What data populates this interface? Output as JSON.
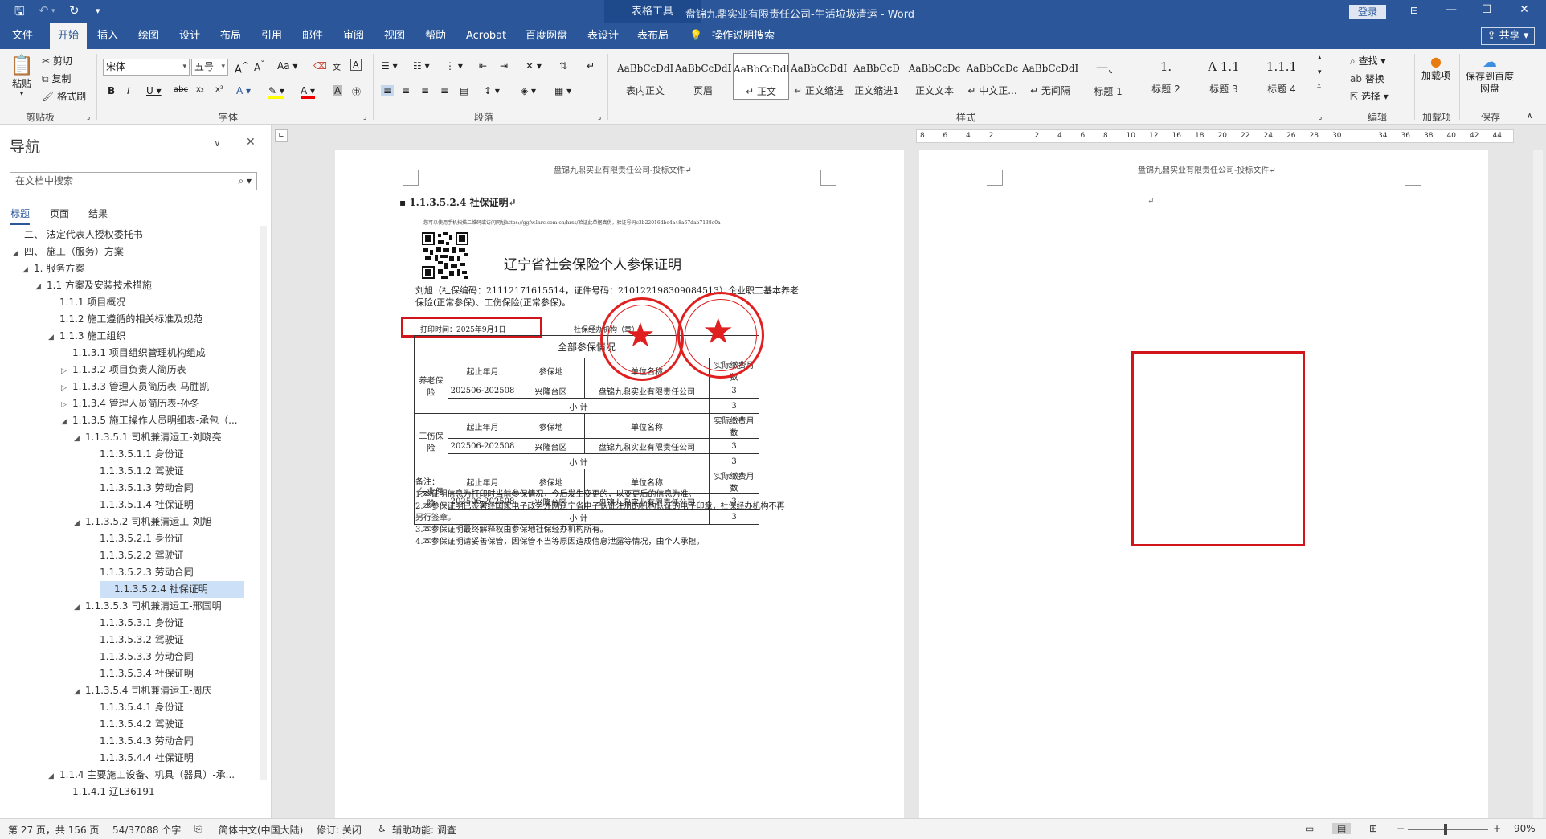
{
  "titlebar": {
    "context_tab": "表格工具",
    "doc_title": "盘锦九鼎实业有限责任公司-生活垃圾清运  -  Word",
    "login": "登录",
    "restore_icon": "ribbon-display-icon",
    "min": "—",
    "max": "☐",
    "close": "✕"
  },
  "tabs": [
    {
      "label": "文件"
    },
    {
      "label": "开始"
    },
    {
      "label": "插入"
    },
    {
      "label": "绘图"
    },
    {
      "label": "设计"
    },
    {
      "label": "布局"
    },
    {
      "label": "引用"
    },
    {
      "label": "邮件"
    },
    {
      "label": "审阅"
    },
    {
      "label": "视图"
    },
    {
      "label": "帮助"
    },
    {
      "label": "Acrobat"
    },
    {
      "label": "百度网盘"
    },
    {
      "label": "表设计"
    },
    {
      "label": "表布局"
    }
  ],
  "tell_me": "操作说明搜索",
  "share": "共享",
  "ribbon": {
    "clipboard": {
      "paste": "粘贴",
      "cut": "剪切",
      "copy": "复制",
      "format_painter": "格式刷",
      "label": "剪贴板"
    },
    "font": {
      "name": "宋体",
      "size": "五号",
      "label": "字体"
    },
    "paragraph": {
      "label": "段落"
    },
    "styles": {
      "label": "样式",
      "items": [
        {
          "preview": "AaBbCcDdI",
          "name": "表内正文"
        },
        {
          "preview": "AaBbCcDdEe",
          "name": "页眉"
        },
        {
          "preview": "AaBbCcDdI",
          "name": "↵ 正文"
        },
        {
          "preview": "AaBbCcDdI",
          "name": "↵ 正文缩进"
        },
        {
          "preview": "AaBbCcD",
          "name": "正文缩进1"
        },
        {
          "preview": "AaBbCcDc",
          "name": "正文文本"
        },
        {
          "preview": "AaBbCcDc",
          "name": "↵ 中文正..."
        },
        {
          "preview": "AaBbCcDdI",
          "name": "↵ 无间隔"
        },
        {
          "preview": "一、",
          "name": "标题 1"
        },
        {
          "preview": "1.",
          "name": "标题 2"
        },
        {
          "preview": "A 1.1",
          "name": "标题 3"
        },
        {
          "preview": "1.1.1",
          "name": "标题 4"
        }
      ]
    },
    "editing": {
      "find": "查找",
      "replace": "替换",
      "select": "选择",
      "label": "编辑"
    },
    "addins": {
      "load": "加载项",
      "label": "加载项"
    },
    "save": {
      "save_to": "保存到百度网盘",
      "label": "保存"
    }
  },
  "nav": {
    "title": "导航",
    "search_placeholder": "在文档中搜索",
    "tabs": [
      "标题",
      "页面",
      "结果"
    ],
    "items": [
      {
        "text": "二、 法定代表人授权委托书",
        "level": 1,
        "caret": ""
      },
      {
        "text": "四、 施工（服务）方案",
        "level": 1,
        "caret": "◢"
      },
      {
        "text": "1. 服务方案",
        "level": 2,
        "caret": "◢"
      },
      {
        "text": "1.1 方案及安装技术措施",
        "level": 3,
        "caret": "◢"
      },
      {
        "text": "1.1.1 项目概况",
        "level": 4,
        "caret": ""
      },
      {
        "text": "1.1.2 施工遵循的相关标准及规范",
        "level": 4,
        "caret": ""
      },
      {
        "text": "1.1.3 施工组织",
        "level": 4,
        "caret": "◢"
      },
      {
        "text": "1.1.3.1 项目组织管理机构组成",
        "level": 5,
        "caret": ""
      },
      {
        "text": "1.1.3.2 项目负责人简历表",
        "level": 5,
        "caret": "▷"
      },
      {
        "text": "1.1.3.3 管理人员简历表-马胜凯",
        "level": 5,
        "caret": "▷"
      },
      {
        "text": "1.1.3.4 管理人员简历表-孙冬",
        "level": 5,
        "caret": "▷"
      },
      {
        "text": "1.1.3.5 施工操作人员明细表-承包（...",
        "level": 5,
        "caret": "◢"
      },
      {
        "text": "1.1.3.5.1 司机兼清运工-刘晓亮",
        "level": 6,
        "caret": "◢"
      },
      {
        "text": "1.1.3.5.1.1 身份证",
        "level": 7,
        "caret": ""
      },
      {
        "text": "1.1.3.5.1.2 驾驶证",
        "level": 7,
        "caret": ""
      },
      {
        "text": "1.1.3.5.1.3 劳动合同",
        "level": 7,
        "caret": ""
      },
      {
        "text": "1.1.3.5.1.4 社保证明",
        "level": 7,
        "caret": ""
      },
      {
        "text": "1.1.3.5.2 司机兼清运工-刘旭",
        "level": 6,
        "caret": "◢"
      },
      {
        "text": "1.1.3.5.2.1 身份证",
        "level": 7,
        "caret": ""
      },
      {
        "text": "1.1.3.5.2.2 驾驶证",
        "level": 7,
        "caret": ""
      },
      {
        "text": "1.1.3.5.2.3 劳动合同",
        "level": 7,
        "caret": ""
      },
      {
        "text": "1.1.3.5.2.4 社保证明",
        "level": 7,
        "caret": "",
        "selected": true
      },
      {
        "text": "1.1.3.5.3 司机兼清运工-邢国明",
        "level": 6,
        "caret": "◢"
      },
      {
        "text": "1.1.3.5.3.1 身份证",
        "level": 7,
        "caret": ""
      },
      {
        "text": "1.1.3.5.3.2 驾驶证",
        "level": 7,
        "caret": ""
      },
      {
        "text": "1.1.3.5.3.3 劳动合同",
        "level": 7,
        "caret": ""
      },
      {
        "text": "1.1.3.5.3.4 社保证明",
        "level": 7,
        "caret": ""
      },
      {
        "text": "1.1.3.5.4 司机兼清运工-周庆",
        "level": 6,
        "caret": "◢"
      },
      {
        "text": "1.1.3.5.4.1 身份证",
        "level": 7,
        "caret": ""
      },
      {
        "text": "1.1.3.5.4.2 驾驶证",
        "level": 7,
        "caret": ""
      },
      {
        "text": "1.1.3.5.4.3 劳动合同",
        "level": 7,
        "caret": ""
      },
      {
        "text": "1.1.3.5.4.4 社保证明",
        "level": 7,
        "caret": ""
      },
      {
        "text": "1.1.4 主要施工设备、机具（器具）-承...",
        "level": 4,
        "caret": "◢"
      },
      {
        "text": "1.1.4.1 辽L36191",
        "level": 5,
        "caret": ""
      }
    ]
  },
  "page1": {
    "header": "盘锦九鼎实业有限责任公司-投标文件↵",
    "heading_num": "1.1.3.5.2.4",
    "heading_text": "社保证明",
    "verify_line": "您可以使用手机扫描二维码或访问网址https://ggfw.lnrc.com.cn/hrss/验证此单据真伪，验证号码c3b22016dbe4a48a67dab7138e0a",
    "cert_title": "辽宁省社会保险个人参保证明",
    "person_line1": "刘旭（社保编码：21112171615514，证件号码：210122198309084513）企业职工基本养老",
    "person_line2": "保险(正常参保)、工伤保险(正常参保)。",
    "print_time": "打印时间：2025年9月1日",
    "agency": "社保经办机构（章）",
    "table_title": "全部参保情况",
    "col_start": "起止年月",
    "col_place": "参保地",
    "col_unit": "单位名称",
    "col_months": "实际缴费月数",
    "subtotal": "小          计",
    "rows": [
      {
        "type": "养老保险",
        "period": "202506-202508",
        "place": "兴隆台区",
        "unit": "盘锦九鼎实业有限责任公司",
        "months": "3",
        "total": "3"
      },
      {
        "type": "工伤保险",
        "period": "202506-202508",
        "place": "兴隆台区",
        "unit": "盘锦九鼎实业有限责任公司",
        "months": "3",
        "total": "3"
      },
      {
        "type": "失业保险",
        "period": "202506-202508",
        "place": "兴隆台区",
        "unit": "盘锦九鼎实业有限责任公司",
        "months": "3",
        "total": "3"
      }
    ],
    "notes_title": "备注：",
    "note1": "1.本证明信息为打印时当前参保情况，今后发生变更的，以变更后的信息为准。",
    "note2a": "2.本参保证明已签署经国家电子政务外网辽宁省电子认证注册的机构认证的电子印章，社保经办机构不再",
    "note2b": "另行签章。",
    "note3": "3.本参保证明最终解释权由参保地社保经办机构所有。",
    "note4": "4.本参保证明请妥善保管，因保管不当等原因造成信息泄露等情况，由个人承担。"
  },
  "page2": {
    "header": "盘锦九鼎实业有限责任公司-投标文件↵",
    "para_mark": "↵"
  },
  "ruler": {
    "marks": [
      "8",
      "6",
      "4",
      "2",
      "",
      "2",
      "4",
      "6",
      "8",
      "10",
      "12",
      "16",
      "18",
      "20",
      "22",
      "24",
      "26",
      "28",
      "30",
      "",
      "34",
      "36",
      "38",
      "40",
      "42",
      "44"
    ]
  },
  "status": {
    "page": "第 27 页，共 156 页",
    "words": "54/37088 个字",
    "lang": "简体中文(中国大陆)",
    "track": "修订: 关闭",
    "access": "辅助功能: 调查",
    "zoom": "90%"
  },
  "colors": {
    "brand": "#2b579a",
    "highlight_box": "#d2141b",
    "stamp": "#e02020"
  }
}
